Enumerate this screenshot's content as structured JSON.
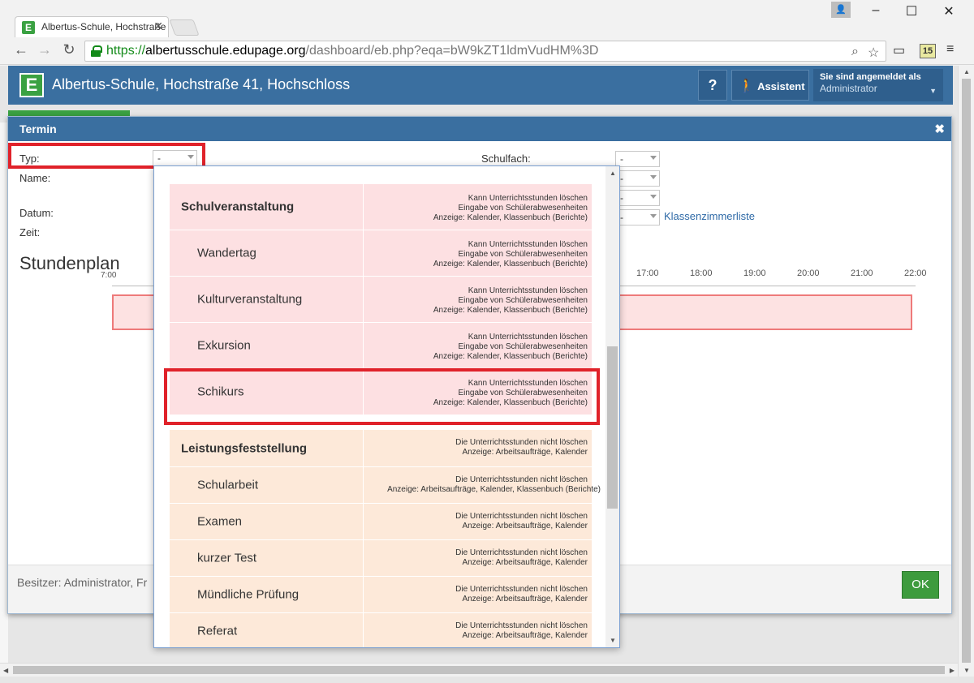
{
  "browser": {
    "tab_title": "Albertus-Schule, Hochstraße",
    "url_scheme": "https://",
    "url_host": "albertusschule.edupage.org",
    "url_path": "/dashboard/eb.php?eqa=bW9kZT1ldmVudHM%3D",
    "extension_badge": "15"
  },
  "app": {
    "title": "Albertus-Schule, Hochstraße 41, Hochschloss",
    "help_label": "?",
    "assistant_label": "Assistent",
    "logged_in_label": "Sie sind angemeldet als",
    "user_name": "Administrator"
  },
  "dialog": {
    "title": "Termin",
    "typ_label": "Typ:",
    "typ_value": "-",
    "name_label": "Name:",
    "datum_label": "Datum:",
    "zeit_label": "Zeit:",
    "schulfach_label": "Schulfach:",
    "select_value": "-",
    "classroom_link": "Klassenzimmerliste",
    "timetable_title": "Stundenplan",
    "hours": [
      "7:00",
      "17:00",
      "18:00",
      "19:00",
      "20:00",
      "21:00",
      "22:00"
    ],
    "owner_text": "Besitzer: Administrator,  Fr",
    "ok_label": "OK"
  },
  "type_dropdown": {
    "groups": [
      {
        "name": "Schulveranstaltung",
        "desc": [
          "Kann Unterrichtsstunden löschen",
          "Eingabe von Schülerabwesenheiten",
          "Anzeige: Kalender, Klassenbuch (Berichte)"
        ],
        "items": [
          {
            "name": "Wandertag",
            "desc": [
              "Kann Unterrichtsstunden löschen",
              "Eingabe von Schülerabwesenheiten",
              "Anzeige: Kalender, Klassenbuch (Berichte)"
            ]
          },
          {
            "name": "Kulturveranstaltung",
            "desc": [
              "Kann Unterrichtsstunden löschen",
              "Eingabe von Schülerabwesenheiten",
              "Anzeige: Kalender, Klassenbuch (Berichte)"
            ]
          },
          {
            "name": "Exkursion",
            "desc": [
              "Kann Unterrichtsstunden löschen",
              "Eingabe von Schülerabwesenheiten",
              "Anzeige: Kalender, Klassenbuch (Berichte)"
            ]
          },
          {
            "name": "Schikurs",
            "desc": [
              "Kann Unterrichtsstunden löschen",
              "Eingabe von Schülerabwesenheiten",
              "Anzeige: Kalender, Klassenbuch (Berichte)"
            ]
          }
        ]
      },
      {
        "name": "Leistungsfeststellung",
        "desc": [
          "Die Unterrichtsstunden nicht löschen",
          "Anzeige: Arbeitsaufträge, Kalender"
        ],
        "items": [
          {
            "name": "Schularbeit",
            "desc": [
              "Die Unterrichtsstunden nicht löschen",
              "Anzeige: Arbeitsaufträge, Kalender, Klassenbuch (Berichte)"
            ]
          },
          {
            "name": "Examen",
            "desc": [
              "Die Unterrichtsstunden nicht löschen",
              "Anzeige: Arbeitsaufträge, Kalender"
            ]
          },
          {
            "name": "kurzer Test",
            "desc": [
              "Die Unterrichtsstunden nicht löschen",
              "Anzeige: Arbeitsaufträge, Kalender"
            ]
          },
          {
            "name": "Mündliche Prüfung",
            "desc": [
              "Die Unterrichtsstunden nicht löschen",
              "Anzeige: Arbeitsaufträge, Kalender"
            ]
          },
          {
            "name": "Referat",
            "desc": [
              "Die Unterrichtsstunden nicht löschen",
              "Anzeige: Arbeitsaufträge, Kalender"
            ]
          }
        ]
      }
    ]
  },
  "colors": {
    "header_blue": "#3a6fa0",
    "highlight_red": "#e0222a",
    "pink_row": "#fde0e2",
    "peach_row": "#fde9d9",
    "ok_green": "#3d9b3d"
  }
}
